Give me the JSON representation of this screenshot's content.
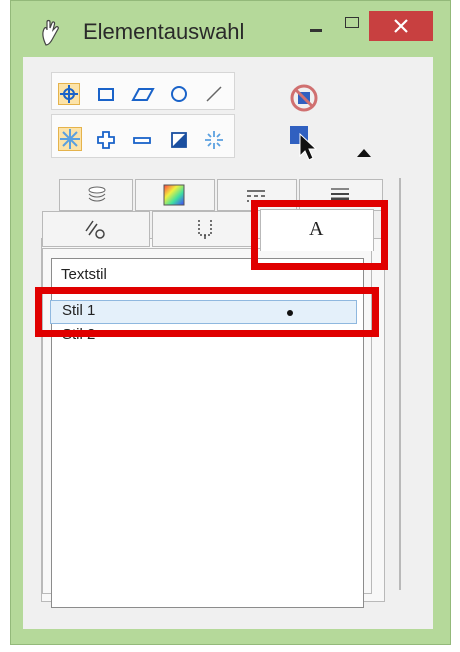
{
  "window": {
    "title": "Elementauswahl",
    "accent_color": "#b5d99a",
    "close_color": "#c84040",
    "highlight_color": "#e00000"
  },
  "toolbar": {
    "row1": [
      "element-selection-icon",
      "rectangle-icon",
      "parallelogram-icon",
      "circle-icon",
      "line-icon"
    ],
    "row2": [
      "invert-selection-icon",
      "add-icon",
      "subtract-icon",
      "toggle-icon",
      "clear-icon"
    ],
    "right": [
      "no-selection-icon",
      "selection-arrow-icon",
      "collapse-arrow-icon"
    ]
  },
  "tabs_top": [
    "layers-icon",
    "color-icon",
    "line-style-icon",
    "line-weight-icon"
  ],
  "tabs_bottom": {
    "items": [
      "level-symbol-icon",
      "template-icon",
      "text-style-tab"
    ],
    "text_tab_label": "A"
  },
  "list": {
    "header": "Textstil",
    "items": [
      {
        "label": "Stil 1",
        "selected": true
      },
      {
        "label": "Stil 2",
        "selected": false
      }
    ]
  }
}
